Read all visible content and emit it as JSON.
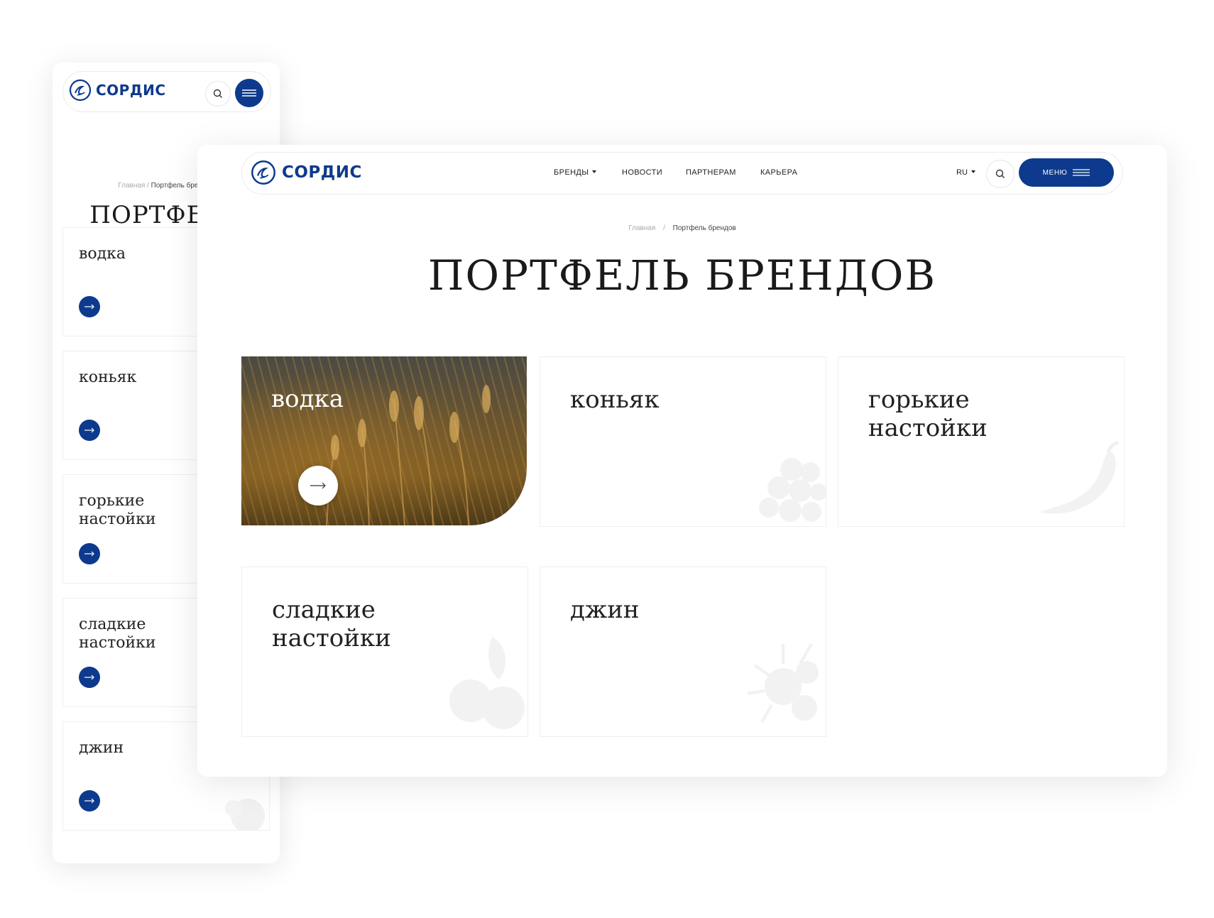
{
  "brand": {
    "name": "СОРДИС",
    "accent_color": "#0d3a8c"
  },
  "mobile": {
    "breadcrumb": {
      "home": "Главная",
      "separator": "/",
      "current": "Портфель брендов"
    },
    "title": "ПОРТФЕЛЬ БРЕНДОВ",
    "icons": {
      "search": "search-icon",
      "menu": "menu-icon",
      "arrow": "arrow-right-icon"
    },
    "cards": [
      {
        "label": "водка"
      },
      {
        "label": "коньяк"
      },
      {
        "label": "горькие настойки"
      },
      {
        "label": "сладкие настойки"
      },
      {
        "label": "джин"
      }
    ]
  },
  "desktop": {
    "nav": [
      {
        "label": "БРЕНДЫ",
        "has_dropdown": true
      },
      {
        "label": "НОВОСТИ"
      },
      {
        "label": "ПАРТНЕРАМ"
      },
      {
        "label": "КАРЬЕРА"
      }
    ],
    "lang": "RU",
    "menu_label": "МЕНЮ",
    "breadcrumb": {
      "home": "Главная",
      "separator": "/",
      "current": "Портфель брендов"
    },
    "title": "ПОРТФЕЛЬ БРЕНДОВ",
    "cards": [
      {
        "label": "водка",
        "active": true,
        "decor_icon": "wheat-image"
      },
      {
        "label": "коньяк",
        "decor_icon": "grapes-icon"
      },
      {
        "label": "горькие настойки",
        "decor_icon": "pepper-icon"
      },
      {
        "label": "сладкие настойки",
        "decor_icon": "berries-icon"
      },
      {
        "label": "джин",
        "decor_icon": "juniper-icon"
      }
    ]
  }
}
